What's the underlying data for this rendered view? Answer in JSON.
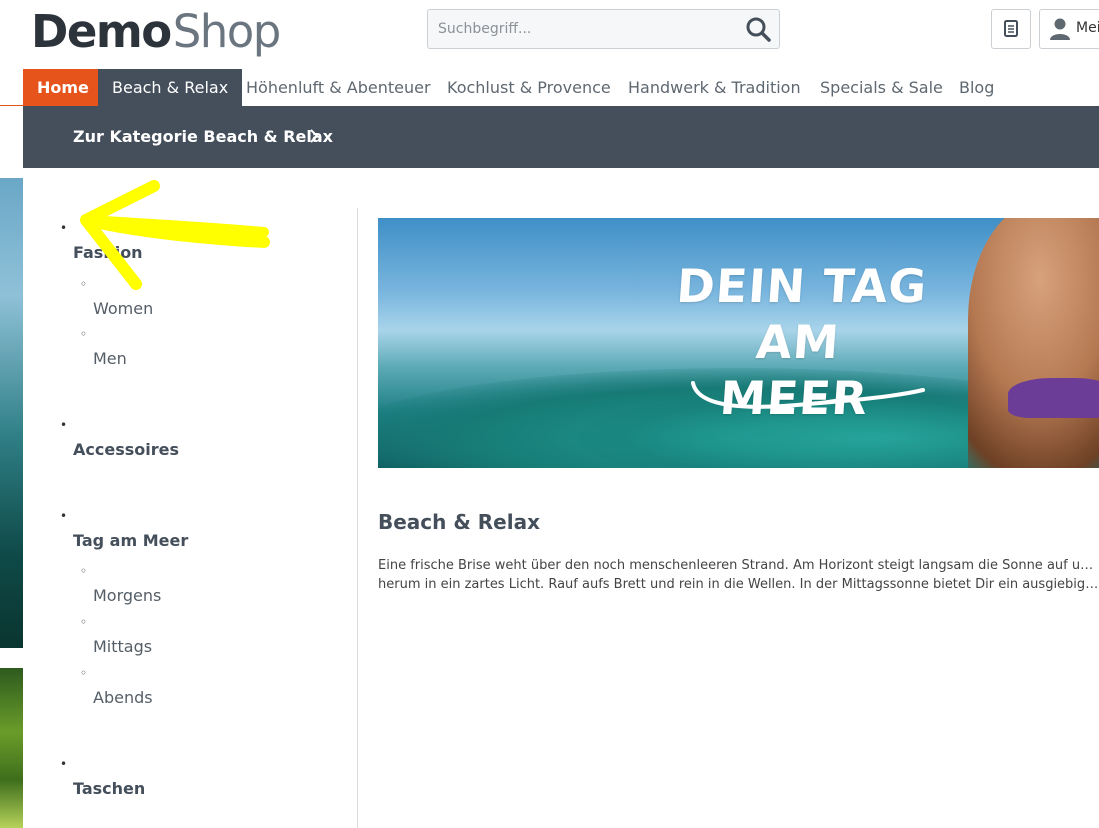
{
  "header": {
    "logo_demo": "Demo",
    "logo_shop": "Shop",
    "search_placeholder": "Suchbegriff...",
    "account_label": "Mei"
  },
  "nav": {
    "items": [
      {
        "label": "Home"
      },
      {
        "label": "Beach & Relax"
      },
      {
        "label": "Höhenluft & Abenteuer"
      },
      {
        "label": "Kochlust & Provence"
      },
      {
        "label": "Handwerk & Tradition"
      },
      {
        "label": "Specials & Sale"
      },
      {
        "label": "Blog"
      }
    ],
    "active": "Beach & Relax"
  },
  "category_bar": {
    "link_label": "Zur Kategorie Beach & Relax"
  },
  "sidebar": {
    "categories": [
      {
        "label": "Fashion",
        "children": [
          "Women",
          "Men"
        ]
      },
      {
        "label": "Accessoires",
        "children": []
      },
      {
        "label": "Tag am Meer",
        "children": [
          "Morgens",
          "Mittags",
          "Abends"
        ]
      },
      {
        "label": "Taschen",
        "children": []
      }
    ]
  },
  "banner": {
    "headline_line1": "DEIN TAG AM",
    "headline_line2": "MEER"
  },
  "content": {
    "title": "Beach & Relax",
    "text_line1": "Eine frische Brise weht über den noch menschenleeren Strand. Am Horizont steigt langsam die Sonne auf und t",
    "text_line2": "herum in ein zartes Licht. Rauf aufs Brett und rein in die Wellen. In der Mittagssonne bietet Dir ein ausgiebiger..."
  },
  "colors": {
    "accent": "#e6541b",
    "nav_active_bg": "#444f5b",
    "annotation_arrow": "#ffff00"
  },
  "icons": {
    "search": "search-icon",
    "notepad": "notepad-icon",
    "account": "user-icon",
    "chevron": "chevron-right-icon",
    "annotation": "arrow-annotation"
  }
}
